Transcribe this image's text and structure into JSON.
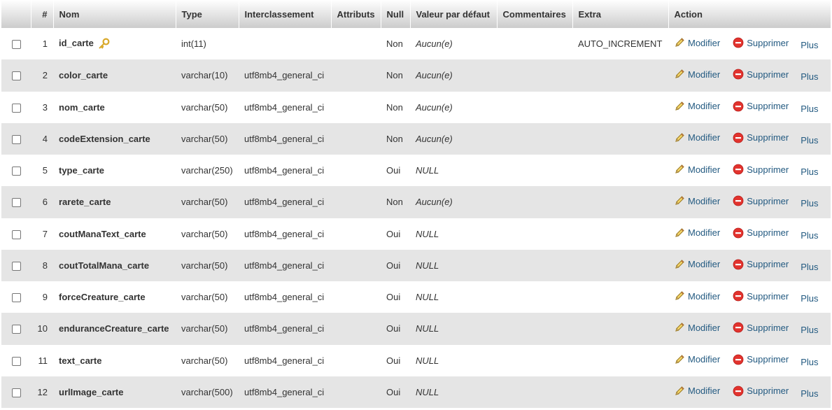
{
  "headers": {
    "num": "#",
    "name": "Nom",
    "type": "Type",
    "collation": "Interclassement",
    "attributes": "Attributs",
    "null": "Null",
    "default": "Valeur par défaut",
    "comments": "Commentaires",
    "extra": "Extra",
    "action": "Action"
  },
  "actions": {
    "modify": "Modifier",
    "delete": "Supprimer",
    "more": "Plus"
  },
  "icons": {
    "primary_key": "key-icon",
    "modify": "pencil-icon",
    "delete": "delete-circle-icon"
  },
  "colors": {
    "link": "#235a81",
    "row_even": "#e5e5e5",
    "row_odd": "#ffffff",
    "delete_icon": "#e2332e",
    "key_icon": "#d9a92b"
  },
  "rows": [
    {
      "num": "1",
      "name": "id_carte",
      "primary": true,
      "type": "int(11)",
      "collation": "",
      "attributes": "",
      "null": "Non",
      "default": "Aucun(e)",
      "comments": "",
      "extra": "AUTO_INCREMENT"
    },
    {
      "num": "2",
      "name": "color_carte",
      "type": "varchar(10)",
      "collation": "utf8mb4_general_ci",
      "attributes": "",
      "null": "Non",
      "default": "Aucun(e)",
      "comments": "",
      "extra": ""
    },
    {
      "num": "3",
      "name": "nom_carte",
      "type": "varchar(50)",
      "collation": "utf8mb4_general_ci",
      "attributes": "",
      "null": "Non",
      "default": "Aucun(e)",
      "comments": "",
      "extra": ""
    },
    {
      "num": "4",
      "name": "codeExtension_carte",
      "type": "varchar(50)",
      "collation": "utf8mb4_general_ci",
      "attributes": "",
      "null": "Non",
      "default": "Aucun(e)",
      "comments": "",
      "extra": ""
    },
    {
      "num": "5",
      "name": "type_carte",
      "type": "varchar(250)",
      "collation": "utf8mb4_general_ci",
      "attributes": "",
      "null": "Oui",
      "default": "NULL",
      "comments": "",
      "extra": ""
    },
    {
      "num": "6",
      "name": "rarete_carte",
      "type": "varchar(50)",
      "collation": "utf8mb4_general_ci",
      "attributes": "",
      "null": "Non",
      "default": "Aucun(e)",
      "comments": "",
      "extra": ""
    },
    {
      "num": "7",
      "name": "coutManaText_carte",
      "type": "varchar(50)",
      "collation": "utf8mb4_general_ci",
      "attributes": "",
      "null": "Oui",
      "default": "NULL",
      "comments": "",
      "extra": ""
    },
    {
      "num": "8",
      "name": "coutTotalMana_carte",
      "type": "varchar(50)",
      "collation": "utf8mb4_general_ci",
      "attributes": "",
      "null": "Oui",
      "default": "NULL",
      "comments": "",
      "extra": ""
    },
    {
      "num": "9",
      "name": "forceCreature_carte",
      "type": "varchar(50)",
      "collation": "utf8mb4_general_ci",
      "attributes": "",
      "null": "Oui",
      "default": "NULL",
      "comments": "",
      "extra": ""
    },
    {
      "num": "10",
      "name": "enduranceCreature_carte",
      "type": "varchar(50)",
      "collation": "utf8mb4_general_ci",
      "attributes": "",
      "null": "Oui",
      "default": "NULL",
      "comments": "",
      "extra": ""
    },
    {
      "num": "11",
      "name": "text_carte",
      "type": "varchar(50)",
      "collation": "utf8mb4_general_ci",
      "attributes": "",
      "null": "Oui",
      "default": "NULL",
      "comments": "",
      "extra": ""
    },
    {
      "num": "12",
      "name": "urlImage_carte",
      "type": "varchar(500)",
      "collation": "utf8mb4_general_ci",
      "attributes": "",
      "null": "Oui",
      "default": "NULL",
      "comments": "",
      "extra": ""
    }
  ]
}
